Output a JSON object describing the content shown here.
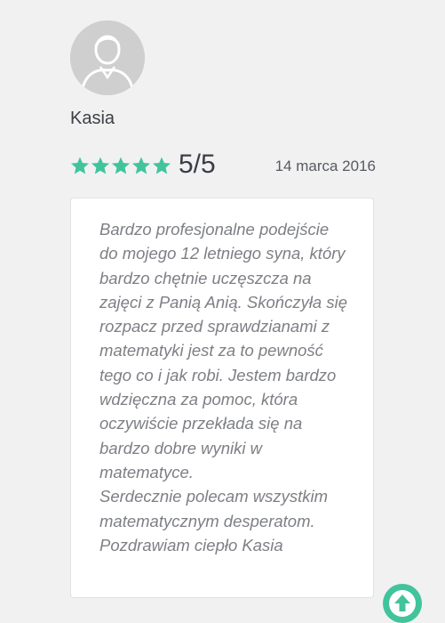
{
  "review": {
    "author": "Kasia",
    "rating": {
      "stars": 5,
      "max_stars": 5,
      "score_text": "5/5",
      "star_color": "#41c49b"
    },
    "date": "14 marca 2016",
    "text_lines": [
      "Bardzo profesjonalne podejście",
      "do mojego 12 letniego syna, który",
      "bardzo chętnie uczęszcza na",
      "zajęci z Panią Anią. Skończyła się",
      "rozpacz przed sprawdzianami z",
      "matematyki jest za to pewność",
      "tego co i jak robi. Jestem bardzo",
      "wdzięczna za pomoc, która",
      "oczywiście przekłada się na",
      "bardzo dobre wyniki w",
      "matematyce.",
      "Serdecznie polecam wszystkim",
      "matematycznym desperatom.",
      "Pozdrawiam ciepło Kasia"
    ]
  },
  "icons": {
    "avatar": "user-silhouette-icon",
    "star": "star-icon",
    "scroll_top": "arrow-up-icon"
  },
  "colors": {
    "accent": "#41c49b",
    "background": "#f1f1f2",
    "avatar_bg": "#cfcfd0"
  }
}
